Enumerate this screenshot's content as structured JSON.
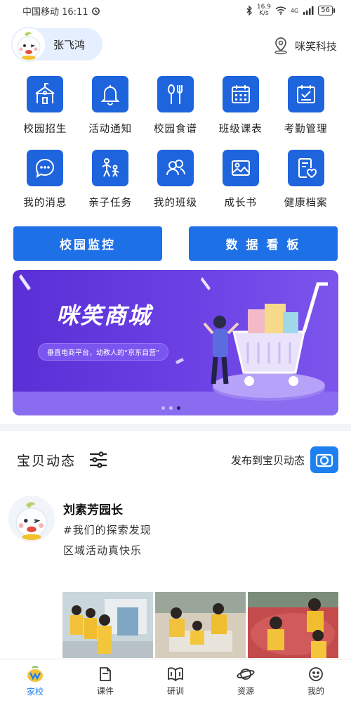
{
  "status_bar": {
    "carrier_time": "中国移动 16:11",
    "speed_value": "16.9",
    "speed_unit": "K/s",
    "network": "4G",
    "battery": "56"
  },
  "header": {
    "user_name": "张飞鸿",
    "company": "咪笑科技"
  },
  "grid": [
    {
      "label": "校园招生",
      "icon": "school-icon"
    },
    {
      "label": "活动通知",
      "icon": "bell-icon"
    },
    {
      "label": "校园食谱",
      "icon": "spoon-fork-icon"
    },
    {
      "label": "班级课表",
      "icon": "calendar-icon"
    },
    {
      "label": "考勤管理",
      "icon": "attendance-icon"
    },
    {
      "label": "我的消息",
      "icon": "chat-icon"
    },
    {
      "label": "亲子任务",
      "icon": "parent-child-icon"
    },
    {
      "label": "我的班级",
      "icon": "class-icon"
    },
    {
      "label": "成长书",
      "icon": "picture-icon"
    },
    {
      "label": "健康档案",
      "icon": "health-record-icon"
    }
  ],
  "buttons": {
    "monitor": "校园监控",
    "dashboard": "数 据 看 板"
  },
  "banner": {
    "title": "咪笑商城",
    "subtitle": "垂直电商平台，幼教人的“京东自营”",
    "active_index": 2
  },
  "feed": {
    "title": "宝贝动态",
    "publish_label": "发布到宝贝动态"
  },
  "post": {
    "author": "刘素芳园长",
    "tag": "#我们的探索发现",
    "text": "区域活动真快乐"
  },
  "tabs": [
    {
      "label": "家校",
      "icon": "home-school-icon",
      "active": true
    },
    {
      "label": "课件",
      "icon": "courseware-icon",
      "active": false
    },
    {
      "label": "研训",
      "icon": "book-icon",
      "active": false
    },
    {
      "label": "资源",
      "icon": "planet-icon",
      "active": false
    },
    {
      "label": "我的",
      "icon": "smile-icon",
      "active": false
    }
  ],
  "colors": {
    "primary": "#1e64dc",
    "button": "#1e70e6",
    "banner": "#5a2fd6",
    "active_tab": "#1e80f0"
  }
}
